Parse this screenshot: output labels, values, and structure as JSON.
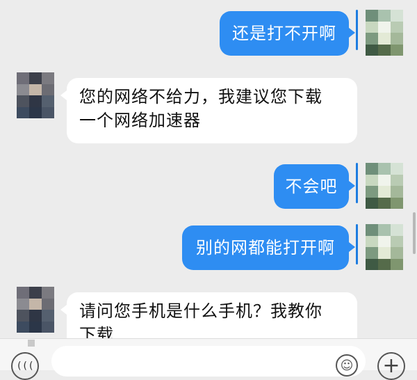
{
  "messages": [
    {
      "side": "out",
      "text": "还是打不开啊"
    },
    {
      "side": "in",
      "lines": [
        "您的网络不给力，我建议您下载",
        "一个网络加速器"
      ]
    },
    {
      "side": "out",
      "text": "不会吧"
    },
    {
      "side": "out",
      "text": "别的网都能打开啊"
    },
    {
      "side": "in",
      "lines": [
        "请问您手机是什么手机？我教你",
        "下载"
      ]
    }
  ],
  "input_bar": {
    "voice_icon": "voice-icon",
    "voice_glyph": "(((",
    "text_value": "",
    "emoji_icon": "emoji-icon",
    "emoji_glyph": "☺",
    "plus_icon": "plus-icon",
    "plus_glyph": "+"
  },
  "colors": {
    "outgoing_bubble": "#2e8df2",
    "incoming_bubble": "#ffffff",
    "background": "#ececec"
  }
}
